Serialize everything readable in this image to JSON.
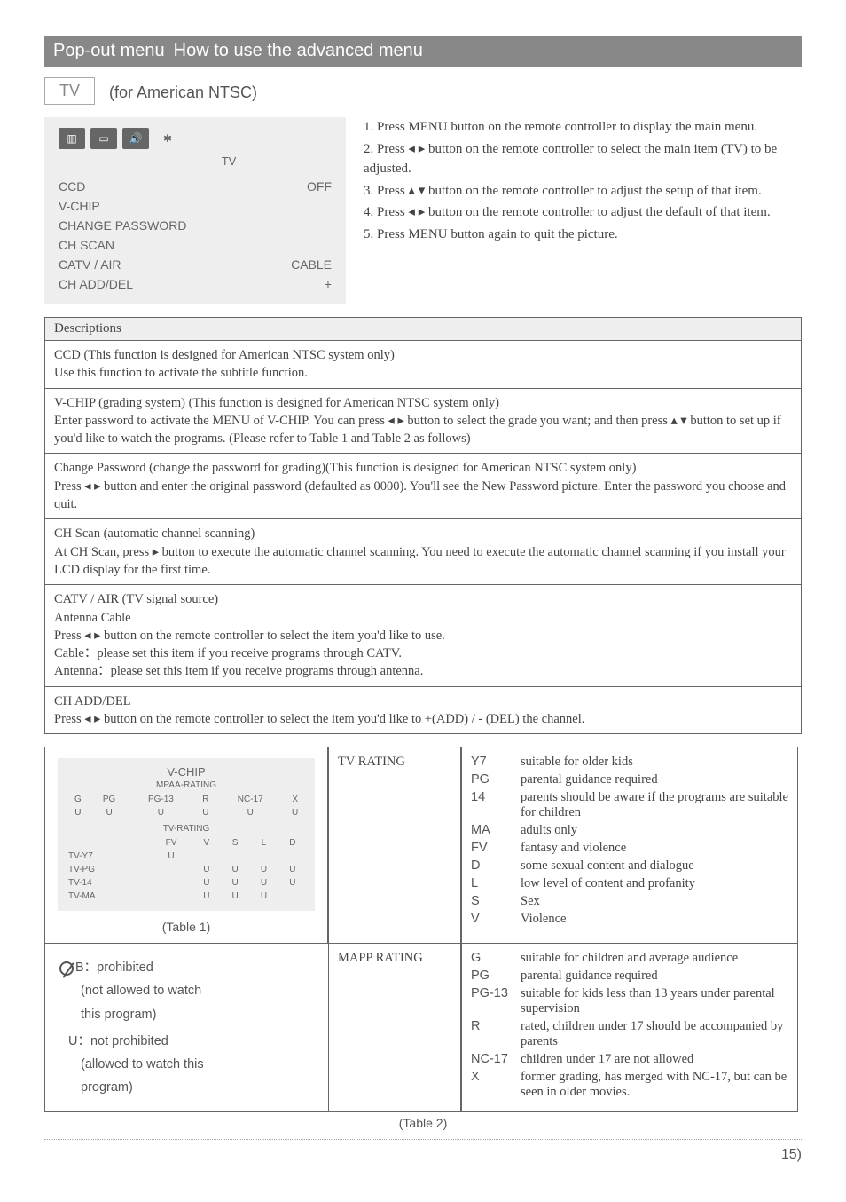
{
  "header": {
    "popout": "Pop-out menu",
    "title": "How to use the advanced menu"
  },
  "tv_section": {
    "tab": "TV",
    "subtitle": "(for American NTSC)"
  },
  "menu_box": {
    "tv_label": "TV",
    "rows": [
      {
        "left": "CCD",
        "right": "OFF"
      },
      {
        "left": "V-CHIP",
        "right": ""
      },
      {
        "left": "CHANGE PASSWORD",
        "right": ""
      },
      {
        "left": "CH SCAN",
        "right": ""
      },
      {
        "left": "CATV / AIR",
        "right": "CABLE"
      },
      {
        "left": "CH ADD/DEL",
        "right": "+"
      }
    ]
  },
  "instructions": [
    "1. Press MENU button on the remote controller to display the main menu.",
    "2. Press ◂ ▸ button on the remote controller to select the main item (TV) to be adjusted.",
    "3. Press ▴ ▾ button on the remote controller to adjust the setup of that item.",
    "4. Press ◂ ▸ button on the remote controller to adjust the default of that item.",
    "5. Press MENU button again to quit the picture."
  ],
  "descriptions": {
    "header": "Descriptions",
    "rows": [
      "CCD  (This function is designed for American NTSC system only)\nUse this function to activate the subtitle function.",
      "V-CHIP (grading system) (This function is designed for American NTSC system only)\nEnter password to activate the MENU of V-CHIP. You can press ◂ ▸ button to select the grade you want; and then press ▴ ▾ button to set up if  you'd like to watch the programs. (Please refer to Table 1 and Table 2 as follows)",
      "Change Password (change the password for grading)(This function is designed for American NTSC system only)\nPress ◂ ▸ button and enter the original password (defaulted as 0000). You'll see the New Password picture. Enter the password you choose and quit.",
      "CH Scan (automatic channel scanning)\nAt CH Scan, press   ▸  button to execute the automatic channel scanning. You need to execute the automatic channel scanning  if you install your LCD display for the first time.",
      "CATV / AIR (TV signal source)\nAntenna       Cable\nPress ◂ ▸ button on the remote controller to select the item you'd like to use.\nCable：please set this item if you receive programs through CATV.\nAntenna：please set this item if you receive programs through antenna.",
      "CH ADD/DEL\nPress ◂ ▸ button on the remote controller to select the item you'd like to +(ADD) / - (DEL) the channel."
    ]
  },
  "vchip_table": {
    "title": "V-CHIP",
    "mpaa_label": "MPAA-RATING",
    "mpaa_cols": [
      "G",
      "PG",
      "PG-13",
      "R",
      "NC-17",
      "X"
    ],
    "mpaa_vals": [
      "U",
      "U",
      "U",
      "U",
      "U",
      "U"
    ],
    "tvrating_label": "TV-RATING",
    "tv_cols": [
      "FV",
      "V",
      "S",
      "L",
      "D"
    ],
    "tv_rows": [
      "TV-Y7",
      "TV-PG",
      "TV-14",
      "TV-MA"
    ],
    "tv_grid": [
      [
        "U",
        "",
        "",
        "",
        ""
      ],
      [
        "",
        "U",
        "U",
        "U",
        "U"
      ],
      [
        "",
        "U",
        "U",
        "U",
        "U"
      ],
      [
        "",
        "U",
        "U",
        "U",
        ""
      ]
    ]
  },
  "table1_caption": "(Table 1)",
  "tv_rating": {
    "label": "TV RATING",
    "rows": [
      {
        "code": "Y7",
        "desc": "suitable for older kids"
      },
      {
        "code": "PG",
        "desc": "parental guidance required"
      },
      {
        "code": "14",
        "desc": "parents should be aware if the programs are suitable for children"
      },
      {
        "code": "MA",
        "desc": "adults only"
      },
      {
        "code": "FV",
        "desc": "fantasy and violence"
      },
      {
        "code": "D",
        "desc": "some sexual content and dialogue"
      },
      {
        "code": "L",
        "desc": "low level of content and profanity"
      },
      {
        "code": "S",
        "desc": "Sex"
      },
      {
        "code": "V",
        "desc": "Violence"
      }
    ]
  },
  "prohibit": {
    "b_line": "B：prohibited",
    "b_sub1": "(not allowed to watch",
    "b_sub2": "this program)",
    "u_line": "U：not prohibited",
    "u_sub1": "(allowed to watch this",
    "u_sub2": "program)"
  },
  "mapp_rating": {
    "label": "MAPP RATING",
    "rows": [
      {
        "code": "G",
        "desc": "suitable for children and average audience"
      },
      {
        "code": "PG",
        "desc": "parental guidance required"
      },
      {
        "code": "PG-13",
        "desc": "suitable for kids less than 13 years under parental supervision"
      },
      {
        "code": "R",
        "desc": "rated, children under 17 should be accompanied by parents"
      },
      {
        "code": "NC-17",
        "desc": "children under 17 are not allowed"
      },
      {
        "code": "X",
        "desc": "former grading, has merged with NC-17, but can be seen in older movies."
      }
    ]
  },
  "table2_caption": "(Table 2)",
  "page_number": "15"
}
